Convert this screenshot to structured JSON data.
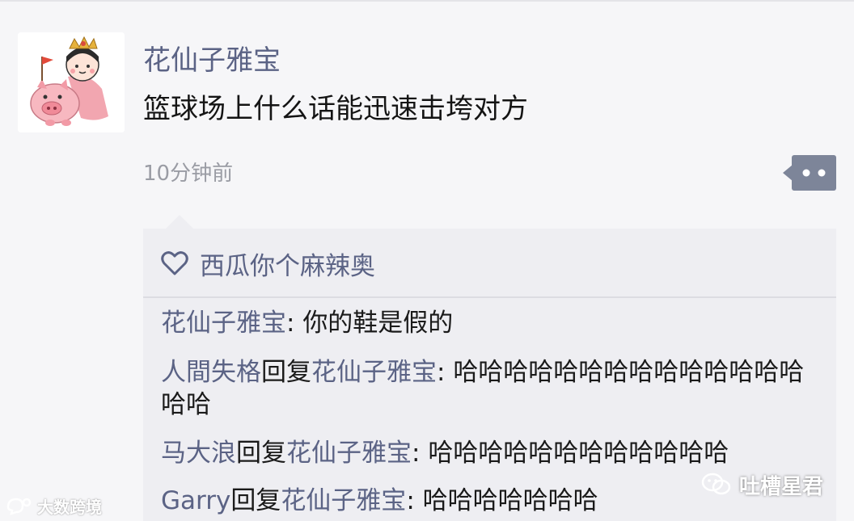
{
  "post": {
    "author": "花仙子雅宝",
    "text": "篮球场上什么话能迅速击垮对方",
    "timestamp": "10分钟前"
  },
  "likes": {
    "icon": "heart-icon",
    "names": "西瓜你个麻辣奥"
  },
  "comments": [
    {
      "name": "花仙子雅宝",
      "reply_word": "",
      "reply_to": "",
      "sep": ": ",
      "text": "你的鞋是假的"
    },
    {
      "name": "人間失格",
      "reply_word": "回复",
      "reply_to": "花仙子雅宝",
      "sep": ": ",
      "text": "哈哈哈哈哈哈哈哈哈哈哈哈哈哈哈哈"
    },
    {
      "name": "马大浪",
      "reply_word": "回复",
      "reply_to": "花仙子雅宝",
      "sep": ": ",
      "text": "哈哈哈哈哈哈哈哈哈哈哈哈"
    },
    {
      "name": "Garry",
      "reply_word": "回复",
      "reply_to": "花仙子雅宝",
      "sep": ": ",
      "text": "哈哈哈哈哈哈哈"
    }
  ],
  "watermarks": {
    "left": "大数跨境",
    "right": "吐槽星君"
  },
  "colors": {
    "name_blue": "#5b6385",
    "background": "#f6f6f8",
    "comment_bg": "#eeeef2",
    "more_button": "#7d8599"
  }
}
